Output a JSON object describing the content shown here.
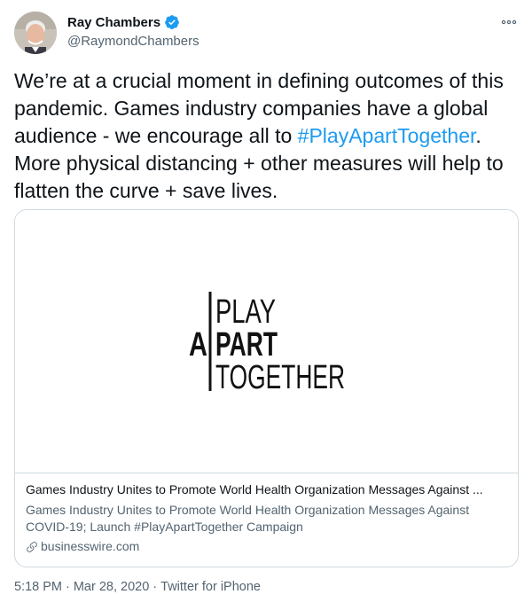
{
  "author": {
    "display_name": "Ray Chambers",
    "handle": "@RaymondChambers",
    "verified": true,
    "avatar_icon": "avatar-photo"
  },
  "tweet": {
    "text_before": "We’re at a crucial moment in defining outcomes of this pandemic. Games industry companies have a global audience - we encourage all to ",
    "hashtag": "#PlayApartTogether",
    "text_after": ". More physical distancing + other measures will help to flatten the curve + save lives."
  },
  "card": {
    "logo": {
      "line1": "PLAY",
      "line2_prefix": "A",
      "line2": "PART",
      "line3": "TOGETHER"
    },
    "title": "Games Industry Unites to Promote World Health Organization Messages Against ...",
    "description": "Games Industry Unites to Promote World Health Organization Messages Against COVID-19; Launch #PlayApartTogether Campaign",
    "source": "businesswire.com"
  },
  "meta": {
    "time": "5:18 PM",
    "separator": "·",
    "date": "Mar 28, 2020",
    "client": "Twitter for iPhone"
  },
  "colors": {
    "link": "#1d9bf0",
    "verified": "#1d9bf0",
    "secondary_text": "#536471",
    "border": "#cfd9de"
  },
  "icons": [
    "verified-badge-icon",
    "more-icon",
    "link-icon"
  ]
}
